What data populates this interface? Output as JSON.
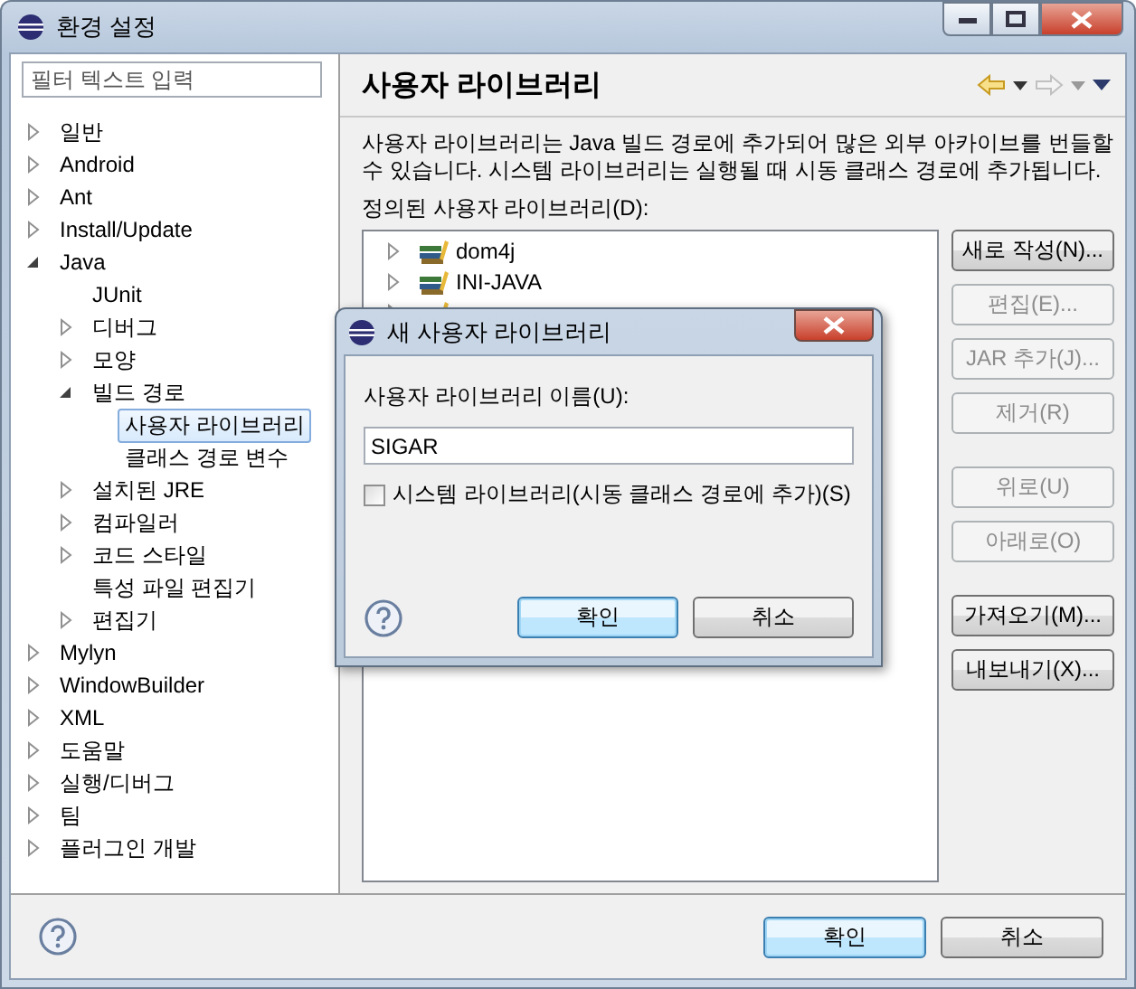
{
  "window": {
    "title": "환경 설정"
  },
  "filter": {
    "placeholder": "필터 텍스트 입력"
  },
  "tree": [
    {
      "label": "일반",
      "expanded": false,
      "selected": false
    },
    {
      "label": "Android",
      "expanded": false,
      "selected": false
    },
    {
      "label": "Ant",
      "expanded": false,
      "selected": false
    },
    {
      "label": "Install/Update",
      "expanded": false,
      "selected": false
    },
    {
      "label": "Java",
      "expanded": true,
      "selected": false,
      "children": [
        {
          "label": "JUnit",
          "selected": false
        },
        {
          "label": "디버그",
          "expanded": false,
          "selected": false
        },
        {
          "label": "모양",
          "expanded": false,
          "selected": false
        },
        {
          "label": "빌드 경로",
          "expanded": true,
          "selected": false,
          "children": [
            {
              "label": "사용자 라이브러리",
              "selected": true
            },
            {
              "label": "클래스 경로 변수",
              "selected": false
            }
          ]
        },
        {
          "label": "설치된 JRE",
          "expanded": false,
          "selected": false
        },
        {
          "label": "컴파일러",
          "expanded": false,
          "selected": false
        },
        {
          "label": "코드 스타일",
          "expanded": false,
          "selected": false
        },
        {
          "label": "특성 파일 편집기",
          "selected": false
        },
        {
          "label": "편집기",
          "expanded": false,
          "selected": false
        }
      ]
    },
    {
      "label": "Mylyn",
      "expanded": false,
      "selected": false
    },
    {
      "label": "WindowBuilder",
      "expanded": false,
      "selected": false
    },
    {
      "label": "XML",
      "expanded": false,
      "selected": false
    },
    {
      "label": "도움말",
      "expanded": false,
      "selected": false
    },
    {
      "label": "실행/디버그",
      "expanded": false,
      "selected": false
    },
    {
      "label": "팀",
      "expanded": false,
      "selected": false
    },
    {
      "label": "플러그인 개발",
      "expanded": false,
      "selected": false
    }
  ],
  "page": {
    "title": "사용자 라이브러리",
    "description": "사용자 라이브러리는 Java 빌드 경로에 추가되어 많은 외부 아카이브를 번들할 수 있습니다. 시스템 라이브러리는 실행될 때 시동 클래스 경로에 추가됩니다.",
    "list_label": "정의된 사용자 라이브러리(D):",
    "libraries": [
      {
        "label": "dom4j",
        "expanded": false
      },
      {
        "label": "INI-JAVA",
        "expanded": false
      },
      {
        "expanded": false
      }
    ],
    "buttons": [
      {
        "label": "새로 작성(N)...",
        "disabled": false
      },
      {
        "label": "편집(E)...",
        "disabled": true
      },
      {
        "label": "JAR 추가(J)...",
        "disabled": true
      },
      {
        "label": "제거(R)",
        "disabled": true
      },
      {
        "label": "위로(U)",
        "disabled": true
      },
      {
        "label": "아래로(O)",
        "disabled": true
      },
      {
        "label": "가져오기(M)...",
        "disabled": false
      },
      {
        "label": "내보내기(X)...",
        "disabled": false
      }
    ]
  },
  "footer": {
    "buttons": [
      {
        "label": "확인",
        "default": true
      },
      {
        "label": "취소",
        "default": false
      }
    ]
  },
  "dialog": {
    "title": "새 사용자 라이브러리",
    "name_label": "사용자 라이브러리 이름(U):",
    "name_value": "SIGAR",
    "system_library": {
      "label": "시스템 라이브러리(시동 클래스 경로에 추가)(S)",
      "checked": false
    },
    "buttons": [
      {
        "label": "확인",
        "default": true
      },
      {
        "label": "취소",
        "default": false
      }
    ]
  }
}
